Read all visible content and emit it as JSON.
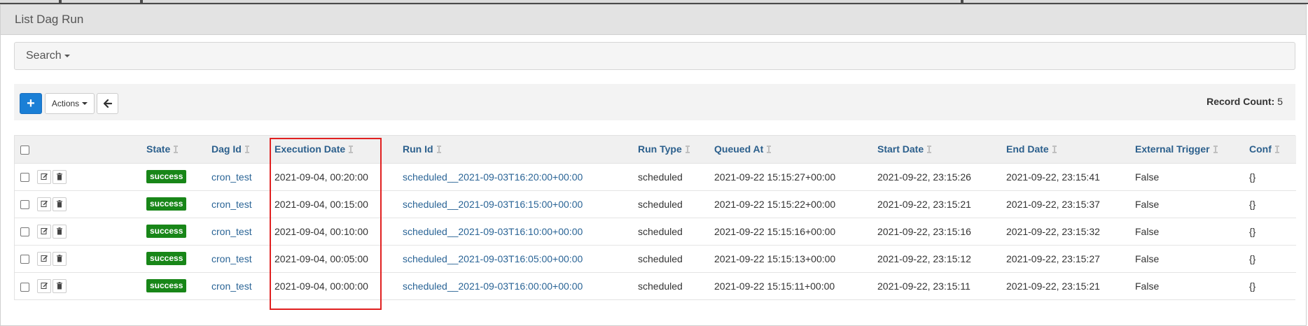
{
  "panel": {
    "title": "List Dag Run"
  },
  "search": {
    "label": "Search"
  },
  "toolbar": {
    "add_label": "+",
    "actions_label": "Actions",
    "record_count_label": "Record Count:",
    "record_count": "5"
  },
  "table": {
    "headers": {
      "state": "State",
      "dag_id": "Dag Id",
      "execution_date": "Execution Date",
      "run_id": "Run Id",
      "run_type": "Run Type",
      "queued_at": "Queued At",
      "start_date": "Start Date",
      "end_date": "End Date",
      "external_trigger": "External Trigger",
      "conf": "Conf"
    },
    "rows": [
      {
        "state": "success",
        "dag_id": "cron_test",
        "execution_date": "2021-09-04, 00:20:00",
        "run_id": "scheduled__2021-09-03T16:20:00+00:00",
        "run_type": "scheduled",
        "queued_at": "2021-09-22 15:15:27+00:00",
        "start_date": "2021-09-22, 23:15:26",
        "end_date": "2021-09-22, 23:15:41",
        "external_trigger": "False",
        "conf": "{}"
      },
      {
        "state": "success",
        "dag_id": "cron_test",
        "execution_date": "2021-09-04, 00:15:00",
        "run_id": "scheduled__2021-09-03T16:15:00+00:00",
        "run_type": "scheduled",
        "queued_at": "2021-09-22 15:15:22+00:00",
        "start_date": "2021-09-22, 23:15:21",
        "end_date": "2021-09-22, 23:15:37",
        "external_trigger": "False",
        "conf": "{}"
      },
      {
        "state": "success",
        "dag_id": "cron_test",
        "execution_date": "2021-09-04, 00:10:00",
        "run_id": "scheduled__2021-09-03T16:10:00+00:00",
        "run_type": "scheduled",
        "queued_at": "2021-09-22 15:15:16+00:00",
        "start_date": "2021-09-22, 23:15:16",
        "end_date": "2021-09-22, 23:15:32",
        "external_trigger": "False",
        "conf": "{}"
      },
      {
        "state": "success",
        "dag_id": "cron_test",
        "execution_date": "2021-09-04, 00:05:00",
        "run_id": "scheduled__2021-09-03T16:05:00+00:00",
        "run_type": "scheduled",
        "queued_at": "2021-09-22 15:15:13+00:00",
        "start_date": "2021-09-22, 23:15:12",
        "end_date": "2021-09-22, 23:15:27",
        "external_trigger": "False",
        "conf": "{}"
      },
      {
        "state": "success",
        "dag_id": "cron_test",
        "execution_date": "2021-09-04, 00:00:00",
        "run_id": "scheduled__2021-09-03T16:00:00+00:00",
        "run_type": "scheduled",
        "queued_at": "2021-09-22 15:15:11+00:00",
        "start_date": "2021-09-22, 23:15:11",
        "end_date": "2021-09-22, 23:15:21",
        "external_trigger": "False",
        "conf": "{}"
      }
    ]
  },
  "colors": {
    "success_badge": "#188618",
    "add_button": "#1a7fd6",
    "link": "#2a6496",
    "highlight_box": "#e02020"
  },
  "icons": {
    "edit": "edit-icon",
    "delete": "trash-icon",
    "back": "arrow-left-icon",
    "sort": "sort-icon"
  }
}
